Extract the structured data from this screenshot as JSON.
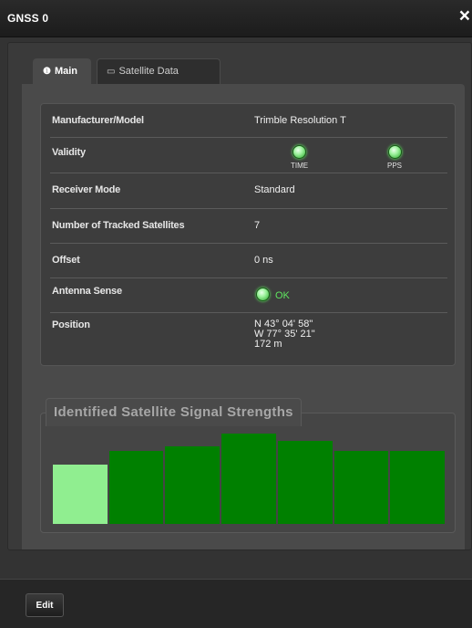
{
  "window": {
    "title": "GNSS 0",
    "close_icon": "×"
  },
  "tabs": [
    {
      "label": "Main",
      "icon": "info-icon",
      "glyph": "❶",
      "active": true
    },
    {
      "label": "Satellite Data",
      "icon": "image-icon",
      "glyph": "▭",
      "active": false
    }
  ],
  "fields": {
    "manufacturer": {
      "label": "Manufacturer/Model",
      "value": "Trimble Resolution T"
    },
    "validity": {
      "label": "Validity",
      "time_label": "TIME",
      "pps_label": "PPS",
      "led_color": "#7ee87e"
    },
    "receiver_mode": {
      "label": "Receiver Mode",
      "value": "Standard"
    },
    "tracked": {
      "label": "Number of Tracked Satellites",
      "value": "7"
    },
    "offset": {
      "label": "Offset",
      "value": "0 ns"
    },
    "antenna": {
      "label": "Antenna Sense",
      "value": "OK"
    },
    "position": {
      "label": "Position",
      "lat": "N 43° 04' 58\"",
      "lon": "W 77° 35' 21\"",
      "alt": "172 m"
    }
  },
  "chart_data": {
    "type": "bar",
    "title": "Identified Satellite Signal Strengths",
    "values": [
      60,
      74,
      79,
      92,
      84,
      74,
      74
    ],
    "colors": [
      "#90ee90",
      "#008000",
      "#008000",
      "#008000",
      "#008000",
      "#008000",
      "#008000"
    ],
    "ylim": [
      0,
      100
    ]
  },
  "footer": {
    "edit_label": "Edit"
  }
}
